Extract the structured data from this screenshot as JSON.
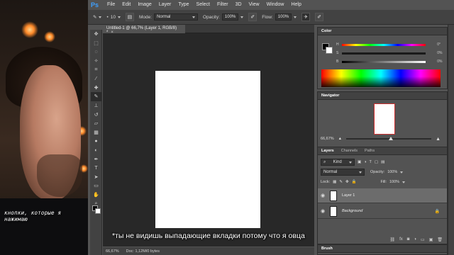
{
  "app": {
    "logo": "Ps"
  },
  "menu": [
    "File",
    "Edit",
    "Image",
    "Layer",
    "Type",
    "Select",
    "Filter",
    "3D",
    "View",
    "Window",
    "Help"
  ],
  "options": {
    "brush_size": "10",
    "mode_label": "Mode:",
    "mode_value": "Normal",
    "opacity_label": "Opacity:",
    "opacity_value": "100%",
    "flow_label": "Flow:",
    "flow_value": "100%"
  },
  "document": {
    "tab_title": "Untitled-1 @ 66,7% (Layer 1, RGB/8) *",
    "zoom": "66,67%",
    "doc_info": "Doc: 1,12M/0 bytes"
  },
  "subtitle": "*ты не видишь выпадающие вкладки потому что я овца",
  "webcam_caption": "кнопки, которые я нажимаю",
  "color_panel": {
    "title": "Color",
    "sliders": [
      {
        "label": "H",
        "value": "0",
        "unit": "°"
      },
      {
        "label": "S",
        "value": "0",
        "unit": "%"
      },
      {
        "label": "B",
        "value": "0",
        "unit": "%"
      }
    ]
  },
  "navigator": {
    "title": "Navigator",
    "zoom": "66,67%"
  },
  "layers": {
    "tabs": [
      "Layers",
      "Channels",
      "Paths"
    ],
    "kind": "Kind",
    "blend_mode": "Normal",
    "opacity_label": "Opacity:",
    "opacity_value": "100%",
    "lock_label": "Lock:",
    "fill_label": "Fill:",
    "fill_value": "100%",
    "items": [
      {
        "name": "Layer 1"
      },
      {
        "name": "Background"
      }
    ]
  },
  "brush_panel": {
    "title": "Brush"
  }
}
